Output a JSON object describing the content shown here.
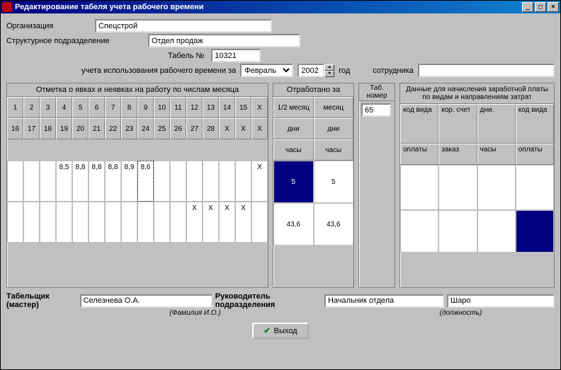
{
  "title": "Редактирование табеля учета рабочего времени",
  "labels": {
    "org": "Организация",
    "dept": "Структурное подразделение",
    "tabel_no": "Табель №",
    "period_prefix": "учета использования рабочего времени за",
    "year_suffix": "год",
    "employee": "сотрудника",
    "attendance_title": "Отметка о явках и неявках на работу по числам месяца",
    "worked_title": "Отработано за",
    "tab_num": "Таб. номер",
    "payroll_title": "Данные для начисления заработной платы по видам и направлениям затрат",
    "timekeeper": "Табельщик (мастер)",
    "dept_head": "Руководитель подразделения",
    "name_hint": "(Фамилия И.О.)",
    "post_hint": "(должность)",
    "exit": "Выход"
  },
  "fields": {
    "org": "Спецстрой",
    "dept": "Отдел продаж",
    "tabel_no": "10321",
    "month": "Февраль",
    "year": "2002",
    "employee": "",
    "tab_no": "65",
    "timekeeper": "Селезнева О.А.",
    "dept_head_post": "Начальник отдела",
    "dept_head_name": "Шаро"
  },
  "att": {
    "days_r1": [
      "1",
      "2",
      "3",
      "4",
      "5",
      "6",
      "7",
      "8",
      "9",
      "10",
      "11",
      "12",
      "13",
      "14",
      "15",
      "X"
    ],
    "days_r2": [
      "16",
      "17",
      "18",
      "19",
      "20",
      "21",
      "22",
      "23",
      "24",
      "25",
      "26",
      "27",
      "28",
      "X",
      "X",
      "X"
    ],
    "data_r1": [
      "",
      "",
      "",
      "8,5",
      "8,8",
      "8,8",
      "8,8",
      "8,9",
      "8,6",
      "",
      "",
      "",
      "",
      "",
      "",
      "X"
    ],
    "data_r2": [
      "",
      "",
      "",
      "",
      "",
      "",
      "",
      "",
      "",
      "",
      "",
      "X",
      "X",
      "X",
      "X",
      ""
    ]
  },
  "wrk": {
    "h1a": "1/2 месяц",
    "h1b": "месяц",
    "h2a": "дни",
    "h2b": "дни",
    "h3a": "часы",
    "h3b": "часы",
    "d1a": "5",
    "d1b": "5",
    "d2a": "43,6",
    "d2b": "43,6"
  },
  "pay": {
    "r1": [
      "код вида",
      "кор. счет",
      "дни.",
      "код вида"
    ],
    "r2": [
      "оплаты",
      "заказ",
      "часы",
      "оплаты"
    ]
  }
}
